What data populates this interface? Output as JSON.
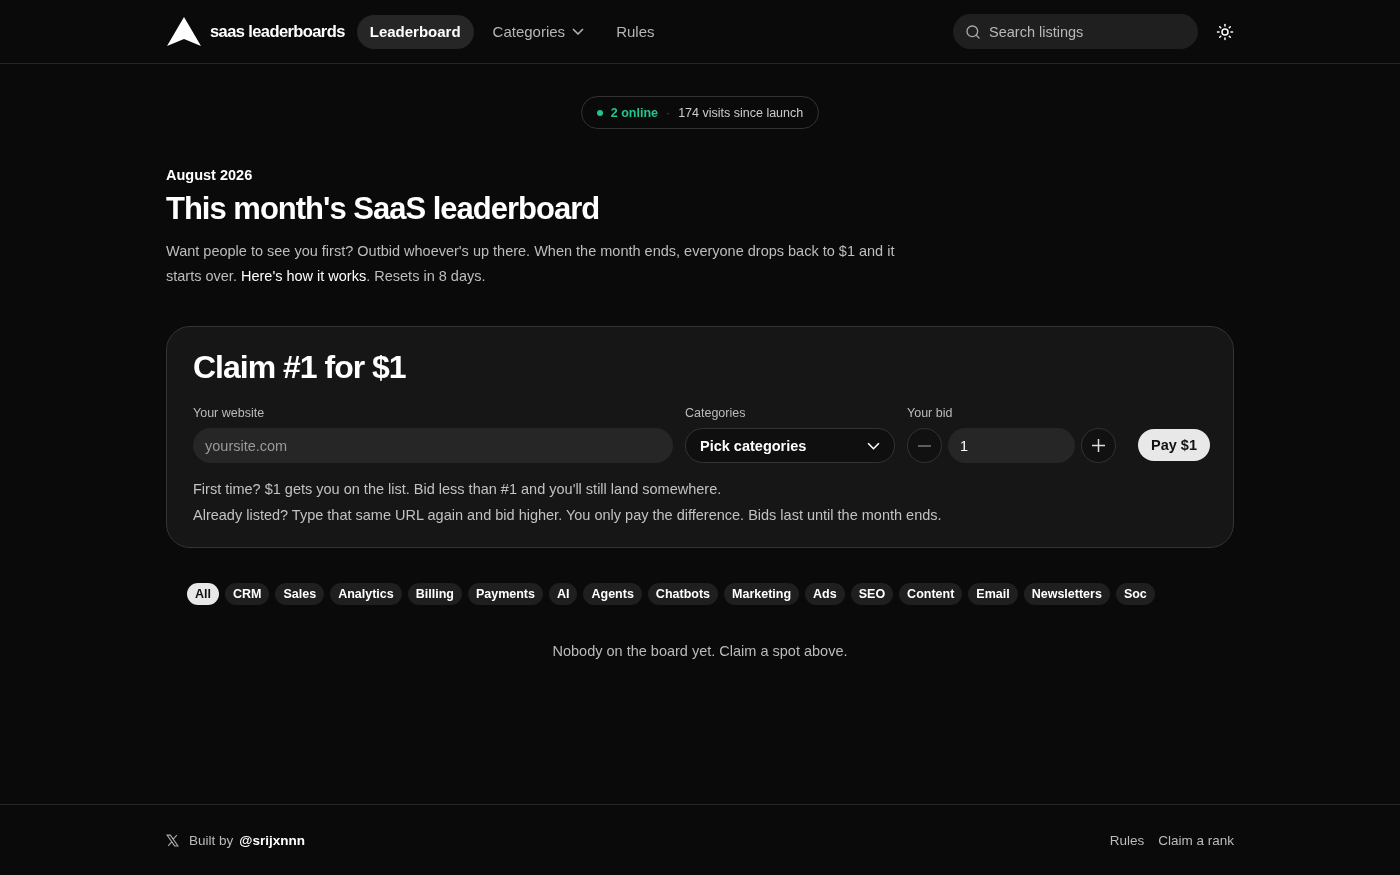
{
  "brand": {
    "name": "saas leaderboards"
  },
  "nav": [
    {
      "label": "Leaderboard",
      "selected": true,
      "kind": "link"
    },
    {
      "label": "Categories",
      "selected": false,
      "kind": "dropdown"
    },
    {
      "label": "Rules",
      "selected": false,
      "kind": "link"
    }
  ],
  "search": {
    "placeholder": "Search listings"
  },
  "presence": {
    "online": "2 online",
    "separator": "·",
    "visits": "174 visits since launch"
  },
  "hero": {
    "eyebrow": "August 2026",
    "title": "This month's SaaS leaderboard",
    "intro": "Want people to see you first? Outbid whoever's up there. When the month ends, everyone drops back to $1 and it starts over.",
    "link": "Here's how it works",
    "outro": ". Resets in 8 days."
  },
  "claim": {
    "title": "Claim #1 for $1",
    "website": {
      "label": "Your website",
      "placeholder": "yoursite.com"
    },
    "categories": {
      "label": "Categories",
      "value": "Pick categories"
    },
    "bid": {
      "label": "Your bid",
      "value": "1"
    },
    "pay": "Pay $1",
    "notes": [
      "First time? $1 gets you on the list. Bid less than #1 and you'll still land somewhere.",
      "Already listed? Type that same URL again and bid higher. You only pay the difference. Bids last until the month ends."
    ]
  },
  "filters": [
    {
      "label": "All",
      "selected": true
    },
    {
      "label": "CRM",
      "selected": false
    },
    {
      "label": "Sales",
      "selected": false
    },
    {
      "label": "Analytics",
      "selected": false
    },
    {
      "label": "Billing",
      "selected": false
    },
    {
      "label": "Payments",
      "selected": false
    },
    {
      "label": "AI",
      "selected": false
    },
    {
      "label": "Agents",
      "selected": false
    },
    {
      "label": "Chatbots",
      "selected": false
    },
    {
      "label": "Marketing",
      "selected": false
    },
    {
      "label": "Ads",
      "selected": false
    },
    {
      "label": "SEO",
      "selected": false
    },
    {
      "label": "Content",
      "selected": false
    },
    {
      "label": "Email",
      "selected": false
    },
    {
      "label": "Newsletters",
      "selected": false
    },
    {
      "label": "Soc",
      "selected": false
    }
  ],
  "empty": "Nobody on the board yet. Claim a spot above.",
  "footer": {
    "built_by": "Built by",
    "handle": "@srijxnnn",
    "links": [
      "Rules",
      "Claim a rank"
    ]
  }
}
